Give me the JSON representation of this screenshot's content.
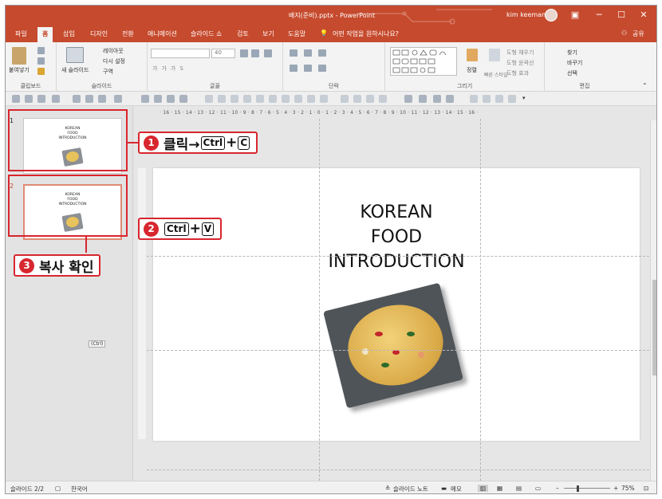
{
  "window": {
    "title": "배지(준비).pptx - PowerPoint",
    "user": "kim keeman"
  },
  "tabs": [
    "파일",
    "홈",
    "삽입",
    "디자인",
    "전환",
    "애니메이션",
    "슬라이드 쇼",
    "검토",
    "보기",
    "도움말"
  ],
  "tell_me": "어떤 작업을 원하시나요?",
  "share": "공유",
  "ribbon": {
    "clipboard": {
      "label": "클립보드",
      "paste": "붙여넣기"
    },
    "slides": {
      "label": "슬라이드",
      "new_slide": "새 슬라이드",
      "layout": "레이아웃",
      "reset": "다시 설정",
      "section": "구역"
    },
    "font": {
      "label": "글꼴",
      "size": "40"
    },
    "paragraph": {
      "label": "단락"
    },
    "drawing": {
      "label": "그리기",
      "arrange": "정렬",
      "quick_styles": "빠른 스타일",
      "fill": "도형 채우기",
      "outline": "도형 윤곽선",
      "effects": "도형 효과"
    },
    "editing": {
      "label": "편집",
      "find": "찾기",
      "replace": "바꾸기",
      "select": "선택"
    }
  },
  "ruler": "· 16 · 15 · 14 · 13 · 12 · 11 · 10 · 9 · 8 · 7 · 6 · 5 · 4 · 3 · 2 · 1 · 0 · 1 · 2 · 3 · 4 · 5 · 6 · 7 · 8 · 9 · 10 · 11 · 12 · 13 · 14 · 15 · 16 ·",
  "thumbnails": [
    {
      "num": "1",
      "lines": [
        "KOREAN",
        "FOOD",
        "INTRODUCTION"
      ]
    },
    {
      "num": "2",
      "lines": [
        "KOREAN",
        "FOOD",
        "INTRODUCTION"
      ]
    }
  ],
  "paste_tag": "(Ctrl)",
  "callouts": [
    {
      "num": "1",
      "text": "클릭→",
      "key1": "Ctrl",
      "plus": "+",
      "key2": "C"
    },
    {
      "num": "2",
      "key1": "Ctrl",
      "plus": "+",
      "key2": "V"
    },
    {
      "num": "3",
      "text": "복사 확인"
    }
  ],
  "slide": {
    "lines": [
      "KOREAN",
      "FOOD",
      "INTRODUCTION"
    ]
  },
  "status": {
    "slide_count": "슬라이드 2/2",
    "language": "한국어",
    "notes": "슬라이드 노트",
    "comments": "메모",
    "zoom": "75%"
  },
  "colors": {
    "accent": "#c64a2d",
    "callout_red": "#d8262f"
  }
}
